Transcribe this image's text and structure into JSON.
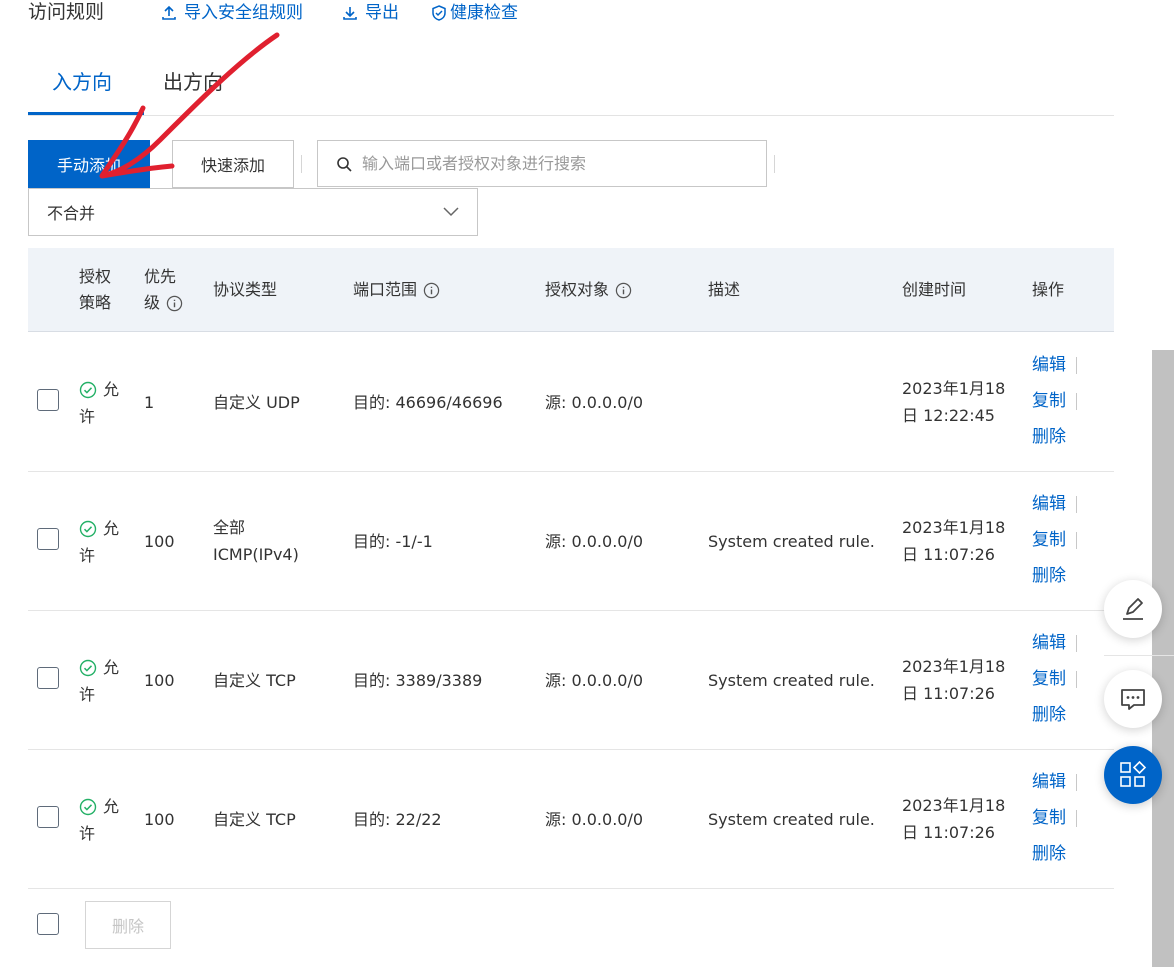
{
  "header": {
    "title": "访问规则",
    "import_label": "导入安全组规则",
    "export_label": "导出",
    "health_label": "健康检查"
  },
  "tabs": [
    {
      "label": "入方向",
      "active": true
    },
    {
      "label": "出方向",
      "active": false
    }
  ],
  "toolbar": {
    "manual_add_label": "手动添加",
    "quick_add_label": "快速添加",
    "search_placeholder": "输入端口或者授权对象进行搜索",
    "merge_select_value": "不合并"
  },
  "table": {
    "columns": {
      "policy_line1": "授权",
      "policy_line2": "策略",
      "priority_line1": "优先",
      "priority_line2": "级",
      "protocol": "协议类型",
      "port_range": "端口范围",
      "auth_object": "授权对象",
      "description": "描述",
      "created": "创建时间",
      "actions": "操作"
    },
    "rows": [
      {
        "policy_line1": "允",
        "policy_line2": "许",
        "priority": "1",
        "protocol_line1": "自定义 UDP",
        "protocol_line2": "",
        "port": "目的: 46696/46696",
        "source": "源: 0.0.0.0/0",
        "description": "",
        "created_line1": "2023年1月18",
        "created_line2": "日 12:22:45"
      },
      {
        "policy_line1": "允",
        "policy_line2": "许",
        "priority": "100",
        "protocol_line1": "全部",
        "protocol_line2": "ICMP(IPv4)",
        "port": "目的: -1/-1",
        "source": "源: 0.0.0.0/0",
        "description": "System created rule.",
        "created_line1": "2023年1月18",
        "created_line2": "日 11:07:26"
      },
      {
        "policy_line1": "允",
        "policy_line2": "许",
        "priority": "100",
        "protocol_line1": "自定义 TCP",
        "protocol_line2": "",
        "port": "目的: 3389/3389",
        "source": "源: 0.0.0.0/0",
        "description": "System created rule.",
        "created_line1": "2023年1月18",
        "created_line2": "日 11:07:26"
      },
      {
        "policy_line1": "允",
        "policy_line2": "许",
        "priority": "100",
        "protocol_line1": "自定义 TCP",
        "protocol_line2": "",
        "port": "目的: 22/22",
        "source": "源: 0.0.0.0/0",
        "description": "System created rule.",
        "created_line1": "2023年1月18",
        "created_line2": "日 11:07:26"
      }
    ],
    "actions": {
      "edit": "编辑",
      "copy": "复制",
      "delete": "删除"
    }
  },
  "footer": {
    "delete_label": "删除"
  },
  "float_buttons": [
    "edit-pen-icon",
    "feedback-chat-icon",
    "apps-grid-icon"
  ],
  "colors": {
    "primary": "#0064c8",
    "success": "#23b066",
    "annotation_arrow": "#e0202f"
  }
}
